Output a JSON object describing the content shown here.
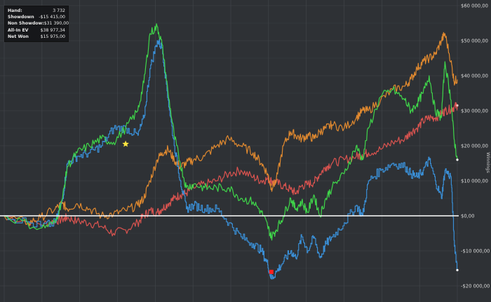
{
  "stats": [
    {
      "label": "Hand:",
      "value": "3 732"
    },
    {
      "label": "Showdown",
      "value": "-$15 415,00"
    },
    {
      "label": "Non Showdow:",
      "value": "$31 390,00"
    },
    {
      "label": "All-In EV",
      "value": "$38 977,34"
    },
    {
      "label": "Net Won",
      "value": "$15 975,00"
    }
  ],
  "chart_data": {
    "type": "line",
    "ylabel": "Winnings",
    "ylim": [
      -22000,
      60000
    ],
    "xlim": [
      0,
      3732
    ],
    "grid": true,
    "yticks": [
      {
        "value": 60000,
        "label": "$60 000,00"
      },
      {
        "value": 50000,
        "label": "$50 000,00"
      },
      {
        "value": 40000,
        "label": "$40 000,00"
      },
      {
        "value": 30000,
        "label": "$30 000,00"
      },
      {
        "value": 20000,
        "label": "$20 000,00"
      },
      {
        "value": 10000,
        "label": "$10 000,00"
      },
      {
        "value": 0,
        "label": "$0,00"
      },
      {
        "value": -10000,
        "label": "-$10 000,00"
      },
      {
        "value": -20000,
        "label": "-$20 000,00"
      }
    ],
    "colors": {
      "background": "#2e3135",
      "grid": "#43474c",
      "zero": "#ffffff",
      "showdown": "#3a8fd6",
      "netwon": "#3fd64a",
      "nonshowdown": "#e0892f",
      "allin": "#d9534f"
    },
    "series": [
      {
        "key": "showdown",
        "color": "#3a8fd6",
        "x": [
          0,
          300,
          420,
          480,
          520,
          600,
          700,
          800,
          900,
          1000,
          1100,
          1150,
          1200,
          1260,
          1300,
          1350,
          1400,
          1450,
          1500,
          1560,
          1650,
          1750,
          1850,
          1950,
          2050,
          2120,
          2170,
          2200,
          2240,
          2300,
          2360,
          2400,
          2450,
          2500,
          2550,
          2600,
          2650,
          2700,
          2800,
          2900,
          2950,
          3000,
          3100,
          3200,
          3300,
          3350,
          3400,
          3450,
          3500,
          3550,
          3600,
          3630,
          3680,
          3705,
          3732
        ],
        "y": [
          0,
          -3000,
          -2000,
          5000,
          15000,
          17000,
          18000,
          20000,
          25000,
          25000,
          23000,
          28000,
          42000,
          50000,
          48000,
          33000,
          20000,
          10000,
          2000,
          3000,
          2000,
          2000,
          -2000,
          -6000,
          -8000,
          -10000,
          -14000,
          -18000,
          -16000,
          -13000,
          -10000,
          -12000,
          -6000,
          -10000,
          -6000,
          -12000,
          -8000,
          -6000,
          -2000,
          3000,
          0,
          10000,
          13000,
          15000,
          14000,
          12000,
          11000,
          13000,
          16000,
          10000,
          5000,
          13000,
          11000,
          -7000,
          -15500
        ]
      },
      {
        "key": "netwon",
        "color": "#3fd64a",
        "x": [
          0,
          300,
          420,
          480,
          520,
          600,
          700,
          800,
          900,
          1000,
          1100,
          1150,
          1200,
          1260,
          1300,
          1350,
          1400,
          1450,
          1500,
          1560,
          1650,
          1750,
          1850,
          1950,
          2050,
          2120,
          2170,
          2200,
          2240,
          2300,
          2360,
          2400,
          2450,
          2500,
          2550,
          2600,
          2650,
          2700,
          2800,
          2900,
          2950,
          3000,
          3100,
          3200,
          3300,
          3350,
          3400,
          3450,
          3500,
          3550,
          3600,
          3630,
          3680,
          3705,
          3732
        ],
        "y": [
          0,
          -3500,
          -2000,
          5000,
          14000,
          18000,
          20000,
          22000,
          21000,
          25000,
          30000,
          38000,
          52000,
          54000,
          49000,
          35000,
          23000,
          15000,
          8000,
          9000,
          8000,
          8000,
          8000,
          5000,
          4000,
          1000,
          -3000,
          -6000,
          -4000,
          0,
          5000,
          2000,
          4000,
          1000,
          6000,
          0,
          5000,
          8000,
          12000,
          20000,
          16000,
          25000,
          34000,
          36000,
          33000,
          30000,
          32000,
          35000,
          40000,
          30000,
          28000,
          44000,
          33000,
          22000,
          16000
        ]
      },
      {
        "key": "nonshowdown",
        "color": "#e0892f",
        "x": [
          0,
          200,
          300,
          420,
          480,
          520,
          600,
          700,
          800,
          900,
          1000,
          1100,
          1150,
          1200,
          1260,
          1300,
          1350,
          1400,
          1450,
          1500,
          1560,
          1650,
          1750,
          1850,
          1950,
          2050,
          2120,
          2170,
          2200,
          2240,
          2300,
          2360,
          2400,
          2450,
          2500,
          2550,
          2600,
          2650,
          2700,
          2800,
          2900,
          2950,
          3000,
          3100,
          3200,
          3300,
          3350,
          3400,
          3450,
          3500,
          3550,
          3600,
          3630,
          3680,
          3705,
          3732
        ],
        "y": [
          0,
          -2000,
          -500,
          2000,
          3500,
          2000,
          3500,
          2000,
          0,
          500,
          1500,
          3000,
          5000,
          10000,
          16000,
          18000,
          19000,
          16000,
          14000,
          15000,
          16000,
          17000,
          20000,
          22000,
          20000,
          18000,
          15000,
          12000,
          8000,
          10000,
          20000,
          24000,
          23000,
          22000,
          23000,
          22000,
          24000,
          25000,
          26000,
          25000,
          28000,
          30000,
          30000,
          33000,
          36000,
          37000,
          39000,
          42000,
          44000,
          45000,
          46000,
          50000,
          52000,
          44000,
          38500,
          38900
        ]
      },
      {
        "key": "allin",
        "color": "#d9534f",
        "x": [
          0,
          300,
          420,
          480,
          520,
          600,
          700,
          800,
          900,
          1000,
          1100,
          1150,
          1200,
          1260,
          1300,
          1350,
          1400,
          1450,
          1500,
          1560,
          1650,
          1750,
          1850,
          1950,
          2050,
          2120,
          2170,
          2200,
          2240,
          2300,
          2360,
          2400,
          2450,
          2500,
          2550,
          2600,
          2650,
          2700,
          2800,
          2900,
          2950,
          3000,
          3100,
          3200,
          3300,
          3350,
          3400,
          3450,
          3500,
          3550,
          3600,
          3630,
          3680,
          3705,
          3732
        ],
        "y": [
          0,
          -2500,
          -1500,
          -1000,
          -500,
          -1500,
          -2000,
          -3000,
          -5000,
          -4000,
          -2000,
          0,
          1500,
          1000,
          2000,
          3500,
          5000,
          6000,
          6500,
          8000,
          9000,
          10000,
          12000,
          13000,
          11000,
          10000,
          10500,
          10000,
          9500,
          8500,
          7500,
          6500,
          8500,
          9000,
          9500,
          12000,
          14000,
          15000,
          16000,
          17000,
          17500,
          18000,
          19000,
          21000,
          22000,
          24000,
          25000,
          27000,
          28000,
          28000,
          29000,
          30000,
          30500,
          31000,
          31500
        ]
      }
    ],
    "markers": [
      {
        "shape": "star",
        "color": "#ffe640",
        "x": 1000,
        "y": 20500
      },
      {
        "shape": "square",
        "color": "#ff2020",
        "x": 2200,
        "y": -16000
      },
      {
        "shape": "dot",
        "color": "#ffffff",
        "x": 3732,
        "y": 16000
      },
      {
        "shape": "dot",
        "color": "#ffffff",
        "x": 3732,
        "y": -15500
      },
      {
        "shape": "dot",
        "color": "#f0c0c0",
        "x": 3732,
        "y": 31500
      }
    ]
  }
}
